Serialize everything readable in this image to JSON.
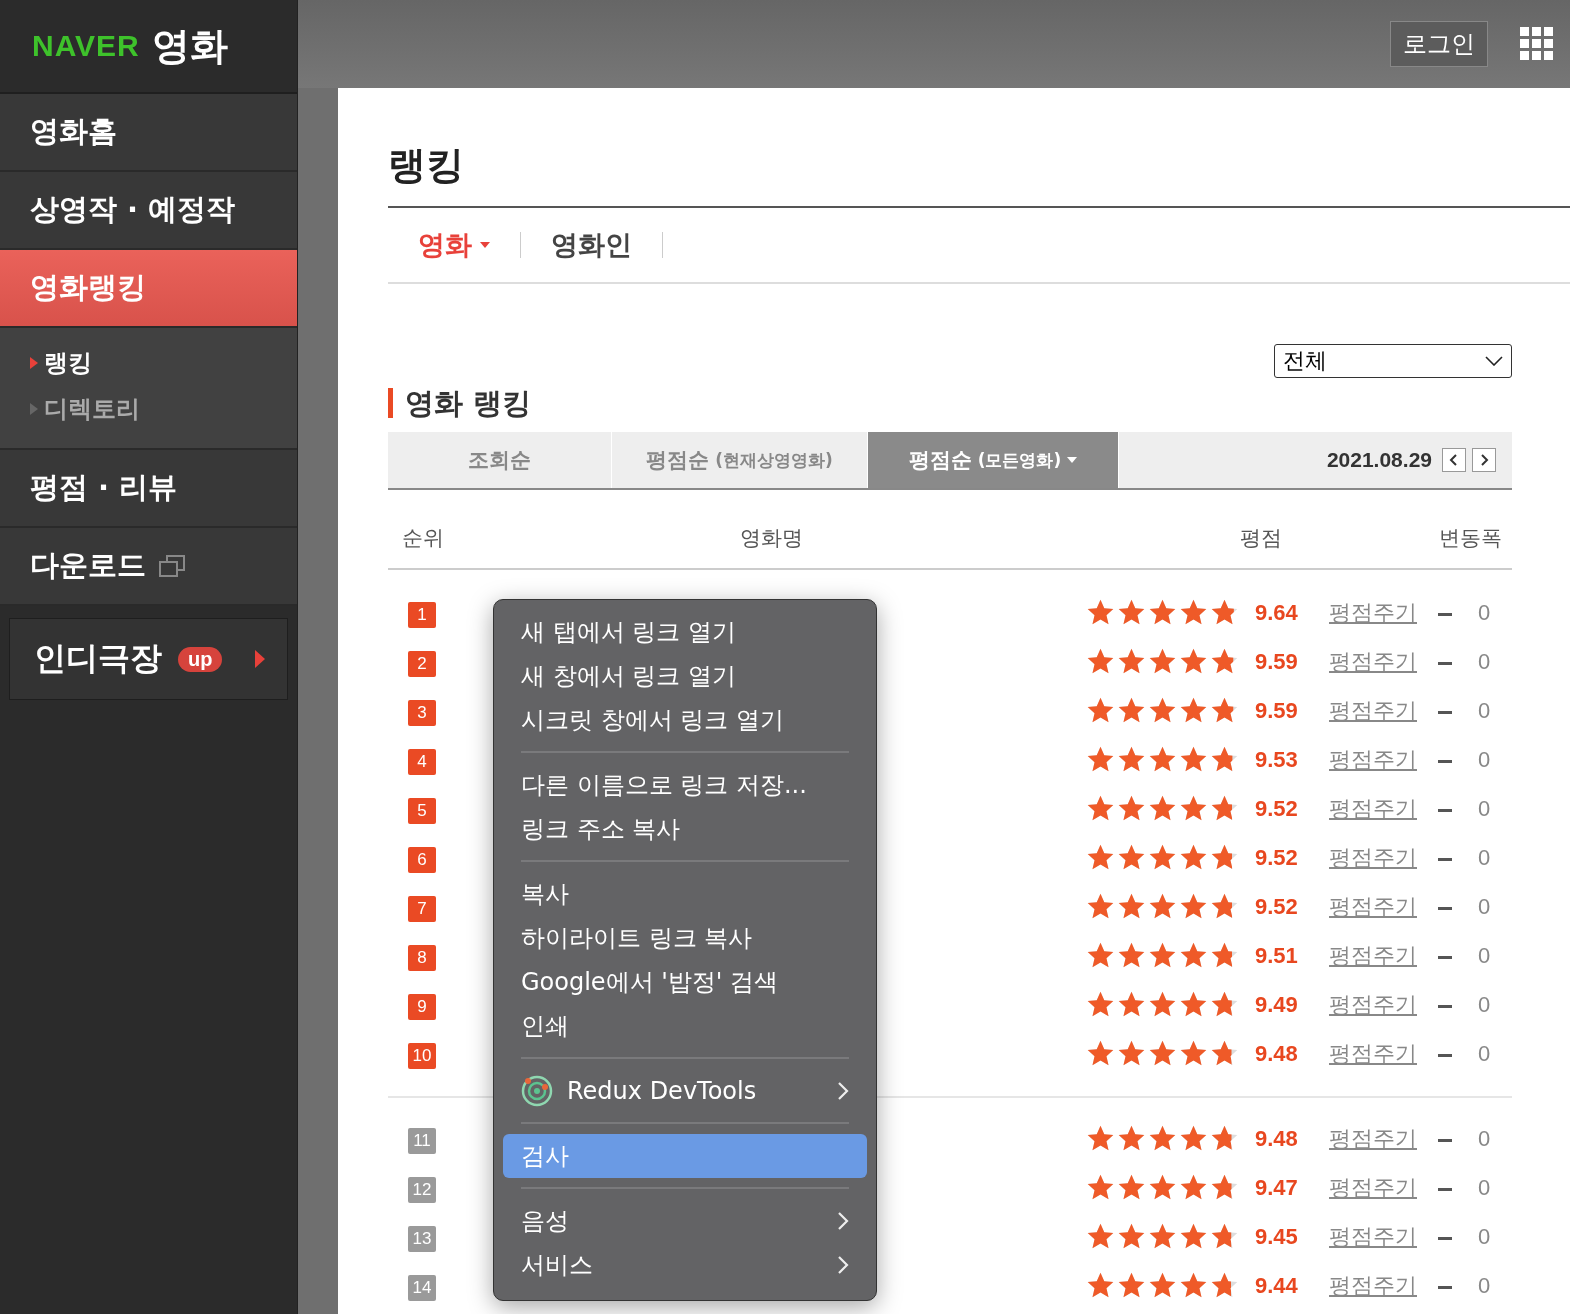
{
  "logo": {
    "brand": "NAVER",
    "service": "영화"
  },
  "sidebar": {
    "items": [
      {
        "label": "영화홈",
        "selected": false
      },
      {
        "label": "상영작 · 예정작",
        "selected": false
      },
      {
        "label": "영화랭킹",
        "selected": true,
        "children": [
          {
            "label": "랭킹",
            "selected": true
          },
          {
            "label": "디렉토리",
            "selected": false
          }
        ]
      },
      {
        "label": "평점 · 리뷰",
        "selected": false
      },
      {
        "label": "다운로드",
        "selected": false,
        "external": true
      }
    ],
    "promo": {
      "label": "인디극장",
      "badge": "up"
    }
  },
  "header": {
    "login": "로그인"
  },
  "page_title": "랭킹",
  "category_tabs": [
    {
      "label": "영화",
      "selected": true
    },
    {
      "label": "영화인",
      "selected": false
    }
  ],
  "filter": {
    "value": "전체"
  },
  "section_title": "영화 랭킹",
  "sort_tabs": [
    {
      "label": "조회순",
      "selected": false
    },
    {
      "label": "평점순",
      "note": "(현재상영영화)",
      "selected": false
    },
    {
      "label": "평점순",
      "note": "(모든영화)",
      "selected": true
    }
  ],
  "date": "2021.08.29",
  "table": {
    "columns": [
      "순위",
      "영화명",
      "평점",
      "변동폭"
    ],
    "rows": [
      {
        "rank": "1",
        "top": true,
        "stars": 4.82,
        "score": "9.64",
        "rate_link": "평점주기",
        "change": "0"
      },
      {
        "rank": "2",
        "top": true,
        "stars": 4.8,
        "score": "9.59",
        "rate_link": "평점주기",
        "change": "0"
      },
      {
        "rank": "3",
        "top": true,
        "stars": 4.8,
        "score": "9.59",
        "rate_link": "평점주기",
        "change": "0"
      },
      {
        "rank": "4",
        "top": true,
        "stars": 4.77,
        "score": "9.53",
        "rate_link": "평점주기",
        "change": "0"
      },
      {
        "rank": "5",
        "top": true,
        "stars": 4.76,
        "score": "9.52",
        "rate_link": "평점주기",
        "change": "0"
      },
      {
        "rank": "6",
        "top": true,
        "stars": 4.76,
        "score": "9.52",
        "rate_link": "평점주기",
        "change": "0"
      },
      {
        "rank": "7",
        "top": true,
        "stars": 4.76,
        "score": "9.52",
        "rate_link": "평점주기",
        "change": "0"
      },
      {
        "rank": "8",
        "top": true,
        "stars": 4.76,
        "score": "9.51",
        "rate_link": "평점주기",
        "change": "0"
      },
      {
        "rank": "9",
        "top": true,
        "stars": 4.75,
        "score": "9.49",
        "rate_link": "평점주기",
        "change": "0"
      },
      {
        "rank": "10",
        "top": true,
        "stars": 4.74,
        "score": "9.48",
        "rate_link": "평점주기",
        "change": "0"
      },
      {
        "rank": "11",
        "top": false,
        "stars": 4.74,
        "score": "9.48",
        "rate_link": "평점주기",
        "change": "0"
      },
      {
        "rank": "12",
        "top": false,
        "stars": 4.74,
        "score": "9.47",
        "rate_link": "평점주기",
        "change": "0"
      },
      {
        "rank": "13",
        "top": false,
        "stars": 4.73,
        "score": "9.45",
        "rate_link": "평점주기",
        "change": "0"
      },
      {
        "rank": "14",
        "top": false,
        "stars": 4.72,
        "score": "9.44",
        "rate_link": "평점주기",
        "change": "0"
      }
    ]
  },
  "context_menu": {
    "items": [
      {
        "kind": "item",
        "label": "새 탭에서 링크 열기",
        "submenu": false,
        "selected": false
      },
      {
        "kind": "item",
        "label": "새 창에서 링크 열기",
        "submenu": false,
        "selected": false
      },
      {
        "kind": "item",
        "label": "시크릿 창에서 링크 열기",
        "submenu": false,
        "selected": false
      },
      {
        "kind": "separator"
      },
      {
        "kind": "item",
        "label": "다른 이름으로 링크 저장...",
        "submenu": false,
        "selected": false
      },
      {
        "kind": "item",
        "label": "링크 주소 복사",
        "submenu": false,
        "selected": false
      },
      {
        "kind": "separator"
      },
      {
        "kind": "item",
        "label": "복사",
        "submenu": false,
        "selected": false
      },
      {
        "kind": "item",
        "label": "하이라이트 링크 복사",
        "submenu": false,
        "selected": false
      },
      {
        "kind": "item",
        "label": "Google에서 '밥정' 검색",
        "submenu": false,
        "selected": false
      },
      {
        "kind": "item",
        "label": "인쇄",
        "submenu": false,
        "selected": false
      },
      {
        "kind": "separator"
      },
      {
        "kind": "extension",
        "label": "Redux DevTools",
        "submenu": true,
        "selected": false
      },
      {
        "kind": "separator"
      },
      {
        "kind": "item",
        "label": "검사",
        "submenu": false,
        "selected": true
      },
      {
        "kind": "separator"
      },
      {
        "kind": "item",
        "label": "음성",
        "submenu": true,
        "selected": false
      },
      {
        "kind": "item",
        "label": "서비스",
        "submenu": true,
        "selected": false
      }
    ]
  }
}
